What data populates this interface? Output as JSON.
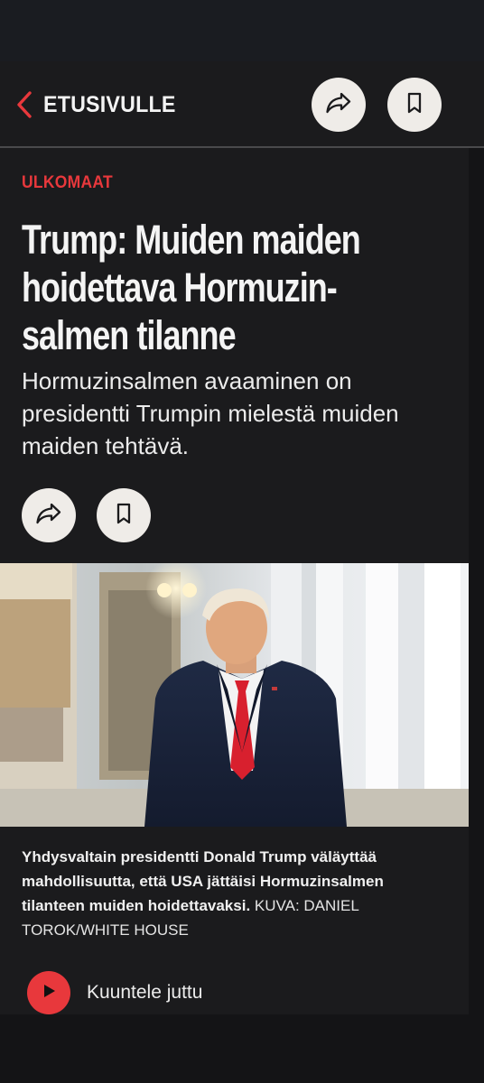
{
  "nav": {
    "back_label": "ETUSIVULLE",
    "back_icon": "chevron-left-icon",
    "share_icon": "share-arrow-icon",
    "bookmark_icon": "bookmark-icon"
  },
  "article": {
    "category": "ULKOMAAT",
    "headline": "Trump: Muiden maiden hoidettava Hormuzin­salmen tilanne",
    "lead": "Hormuzinsalmen avaaminen on presidentti Trumpin mielestä muiden maiden tehtävä.",
    "share_icon": "share-arrow-icon",
    "bookmark_icon": "bookmark-icon"
  },
  "image": {
    "caption": "Yhdysvaltain presidentti Donald Trump väläyttää mahdollisuutta, että USA jättäisi Hormuzinsalmen tilanteen muiden hoidettavaksi.",
    "credit": "KUVA: DANIEL TOROK/WHITE HOUSE"
  },
  "listen": {
    "label": "Kuuntele juttu",
    "icon": "play-icon"
  },
  "colors": {
    "background": "#1b1b1d",
    "accent_red": "#e8383c",
    "button_light": "#efece8",
    "text": "#f4f4f4"
  }
}
